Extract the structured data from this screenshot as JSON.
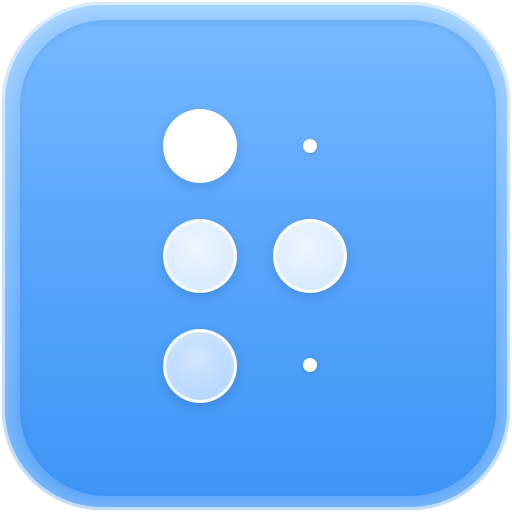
{
  "icon": {
    "semantic_name": "braille-pattern-icon",
    "colors": {
      "tile_top": "#93c9ff",
      "tile_bottom": "#3f96f6",
      "dot_white": "#ffffff",
      "dot_frosted": "#d9ebff",
      "dot_faint": "#b7d8ff"
    },
    "braille_cells": [
      {
        "position": 1,
        "state": "raised-solid"
      },
      {
        "position": 2,
        "state": "raised-frosted"
      },
      {
        "position": 3,
        "state": "raised-faint"
      },
      {
        "position": 4,
        "state": "flat"
      },
      {
        "position": 5,
        "state": "raised-frosted"
      },
      {
        "position": 6,
        "state": "flat"
      }
    ]
  }
}
